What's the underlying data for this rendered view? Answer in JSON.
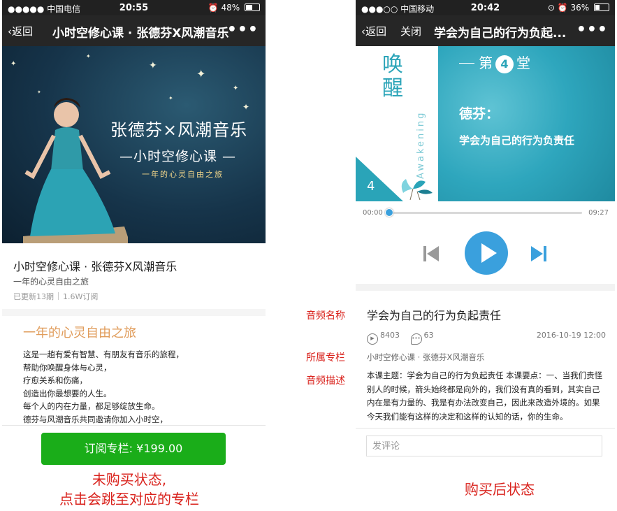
{
  "left_phone": {
    "status": {
      "carrier": "●●●●● 中国电信",
      "time": "20:55",
      "battery": "48%",
      "battery_level": 0.48
    },
    "nav": {
      "back": "返回",
      "title": "小时空修心课 · 张德芬X风潮音乐",
      "more": "•••"
    },
    "cover": {
      "line1": "张德芬×风潮音乐",
      "line2": "—小时空修心课 —",
      "line3": "一年的心灵自由之旅"
    },
    "info": {
      "title": "小时空修心课 · 张德芬X风潮音乐",
      "subtitle": "一年的心灵自由之旅",
      "updated": "已更新13期",
      "subscribers": "1.6W订阅"
    },
    "intro": {
      "heading": "一年的心灵自由之旅",
      "lines": [
        "这是一趟有爱有智慧、有朋友有音乐的旅程，",
        "帮助你唤醒身体与心灵，",
        "疗愈关系和伤痛，",
        "创造出你最想要的人生。",
        "每个人的内在力量，都足够绽放生命。",
        "德芬与风潮音乐共同邀请你加入小时空，"
      ]
    },
    "buy_button": "订阅专栏: ¥199.00",
    "note": [
      "未购买状态,",
      "点击会跳至对应的专栏"
    ]
  },
  "right_phone": {
    "status": {
      "carrier": "●●●○○ 中国移动",
      "time": "20:42",
      "battery": "36%",
      "battery_level": 0.36
    },
    "nav": {
      "back": "返回",
      "close": "关闭",
      "title": "学会为自己的行为负起...",
      "more": "•••"
    },
    "lesson": {
      "huan": "唤醒",
      "awakening": "Awakening",
      "tang_prefix": "第",
      "tang_num": "4",
      "tang_suffix": "堂",
      "author": "德芬：",
      "topic": "学会为自己的行为负责任",
      "corner_num": "4"
    },
    "player": {
      "current": "00:00",
      "total": "09:27",
      "progress": 0.0
    },
    "audio": {
      "title": "学会为自己的行为负起责任",
      "plays": "8403",
      "comments": "63",
      "date": "2016-10-19 12:00",
      "album": "小时空修心课 · 张德芬X风潮音乐",
      "description": "本课主题：学会为自己的行为负起责任 本课要点：一、当我们责怪别人的时候，箭头始终都是向外的，我们没有真的看到，其实自己内在是有力量的、我是有办法改变自己，因此来改造外境的。如果今天我们能有这样的决定和这样的认知的话，你的生命。"
    },
    "comment_placeholder": "发评论",
    "note": "购买后状态"
  },
  "labels": {
    "audio_name": "音频名称",
    "album": "所属专栏",
    "description": "音频描述"
  },
  "colors": {
    "wechat_green": "#1aad19",
    "player_blue": "#3aa0dd",
    "annotation_red": "#d9221c",
    "intro_orange": "#e09c5b",
    "lesson_teal": "#2aa4b8"
  }
}
